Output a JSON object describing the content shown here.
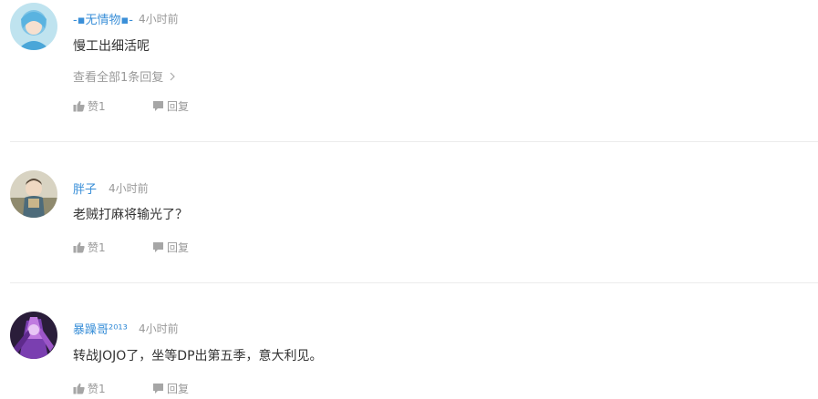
{
  "comments": [
    {
      "username": "-▪无情物▪-",
      "time": "4小时前",
      "content": "慢工出细活呢",
      "view_replies": "查看全部1条回复",
      "likes_label": "赞1",
      "reply_label": "回复"
    },
    {
      "username": "胖子",
      "time": "4小时前",
      "content": "老贼打麻将输光了？",
      "likes_label": "赞1",
      "reply_label": "回复"
    },
    {
      "username": "暴躁哥²⁰¹³",
      "time": "4小时前",
      "content": "转战JOJO了，坐等DP出第五季，意大利见。",
      "likes_label": "赞1",
      "reply_label": "回复"
    }
  ],
  "colors": {
    "username": "#3a8fd8",
    "meta": "#999999",
    "text": "#333333",
    "divider": "#ececec"
  },
  "icons": {
    "like": "thumbs-up-icon",
    "reply": "speech-bubble-icon",
    "more": "chevron-right-icon"
  }
}
